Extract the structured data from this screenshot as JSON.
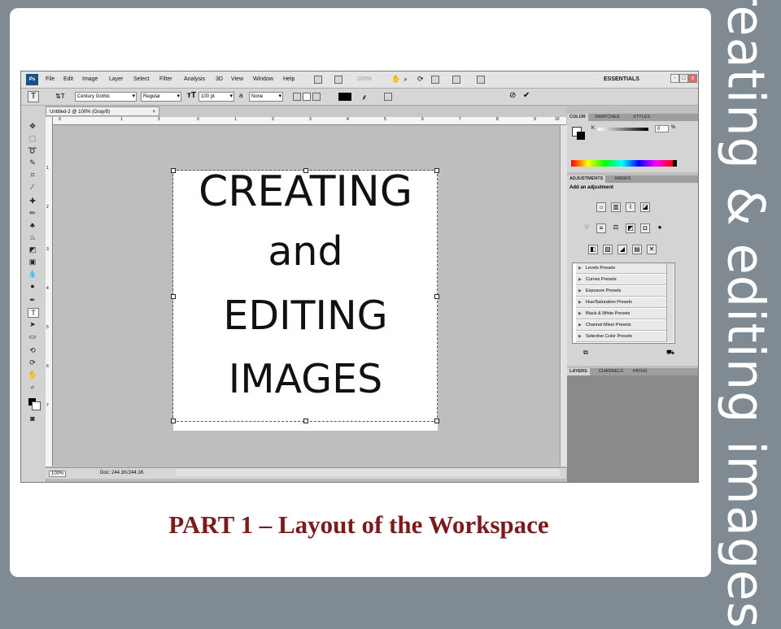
{
  "slide": {
    "side_title": "creating & editing images",
    "caption": "PART 1 – Layout of the Workspace"
  },
  "menubar": {
    "logo": "Ps",
    "menus": [
      "File",
      "Edit",
      "Image",
      "Layer",
      "Select",
      "Filter",
      "Analysis",
      "3D",
      "View",
      "Window",
      "Help"
    ],
    "zoom": "100%",
    "workspace": "ESSENTIALS",
    "window_buttons": [
      "-",
      "□",
      "x"
    ]
  },
  "options_bar": {
    "tool_glyph": "T",
    "font_family": "Century Gothic",
    "font_style": "Regular",
    "font_size": "100 pt",
    "aa_label": "a",
    "antialias": "None"
  },
  "document": {
    "tab_title": "Untitled-2 @ 100% (Gray/8)",
    "tab_close": "×",
    "ruler_ticks": [
      "0",
      "1",
      "2",
      "3",
      "4",
      "5",
      "6",
      "7",
      "8",
      "9",
      "10"
    ],
    "v_ruler_ticks": [
      "1",
      "2",
      "3",
      "4",
      "5",
      "6",
      "7"
    ],
    "canvas_lines": [
      "CREATING",
      "and",
      "EDITING",
      "IMAGES"
    ],
    "status_zoom": "100%",
    "status_doc": "Doc: 244.1K/244.1K"
  },
  "color_panel": {
    "tabs": [
      "COLOR",
      "SWATCHES",
      "STYLES"
    ],
    "channel": "K",
    "value": "0",
    "unit": "%"
  },
  "adjustments_panel": {
    "tabs": [
      "ADJUSTMENTS",
      "MASKS"
    ],
    "heading": "Add an adjustment",
    "presets": [
      "Levels Presets",
      "Curves Presets",
      "Exposure Presets",
      "Hue/Saturation Presets",
      "Black & White Presets",
      "Channel Mixer Presets",
      "Selective Color Presets"
    ]
  },
  "layers_panel": {
    "tabs": [
      "LAYERS",
      "CHANNELS",
      "PATHS"
    ]
  },
  "colors": {
    "caption": "#7b1b1b",
    "background": "#7f8a93",
    "ps_blue": "#1c4e8c"
  }
}
